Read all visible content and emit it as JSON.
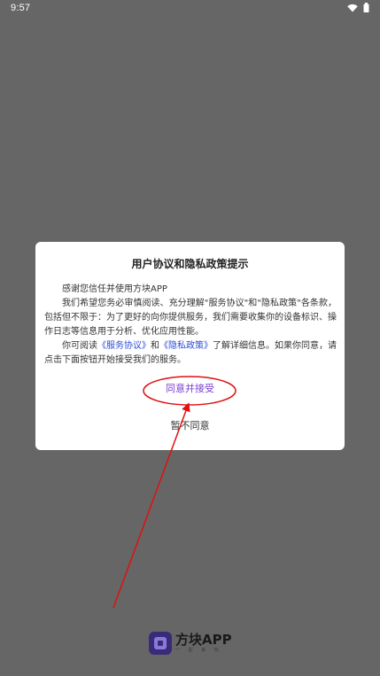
{
  "status_bar": {
    "time": "9:57",
    "icons": [
      "wifi-icon",
      "battery-icon"
    ]
  },
  "dialog": {
    "title": "用户协议和隐私政策提示",
    "para1": "感谢您信任并使用方块APP",
    "para2": "我们希望您务必审慎阅读、充分理解\"服务协议\"和\"隐私政策\"各条款，包括但不限于：为了更好的向你提供服务，我们需要收集你的设备标识、操作日志等信息用于分析、优化应用性能。",
    "para3_prefix": "你可阅读",
    "service_link": "《服务协议》",
    "and_text": "和",
    "privacy_link": "《隐私政策》",
    "para3_suffix": "了解详细信息。如果你同意，请点击下面按钮开始接受我们的服务。",
    "agree_label": "同意并接受",
    "disagree_label": "暂不同意"
  },
  "brand": {
    "name": "方块APP",
    "subtitle": "一 起 来 玩"
  },
  "colors": {
    "background": "#666666",
    "agree": "#7b3fd0",
    "link": "#2b4bd8",
    "annotation": "#e01010"
  }
}
